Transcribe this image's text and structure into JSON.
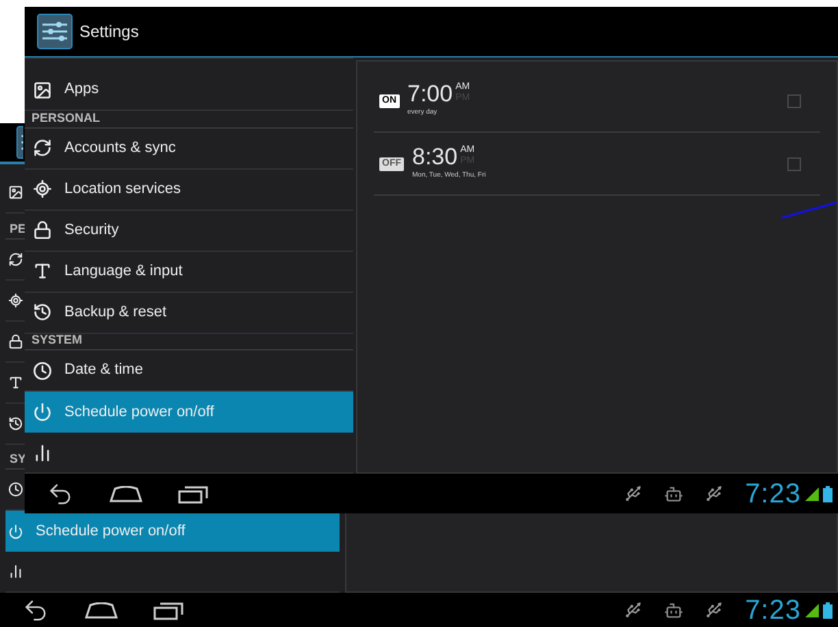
{
  "back_screen": {
    "list": [
      {
        "kind": "item"
      },
      {
        "kind": "header",
        "label": "PE"
      },
      {
        "kind": "item"
      },
      {
        "kind": "item"
      },
      {
        "kind": "item"
      },
      {
        "kind": "item"
      },
      {
        "kind": "item"
      },
      {
        "kind": "header",
        "label": "SY"
      },
      {
        "kind": "item"
      },
      {
        "kind": "item",
        "label": "Schedule power on/off",
        "selected": true
      },
      {
        "kind": "item",
        "selected": false
      }
    ],
    "status_bar": {
      "time": "7:23"
    }
  },
  "front_screen": {
    "title": "Settings",
    "list": [
      {
        "kind": "item",
        "label": "Apps",
        "selected": false
      },
      {
        "kind": "header",
        "label": "PERSONAL"
      },
      {
        "kind": "item",
        "label": "Accounts & sync",
        "selected": false
      },
      {
        "kind": "item",
        "label": "Location services",
        "selected": false
      },
      {
        "kind": "item",
        "label": "Security",
        "selected": false
      },
      {
        "kind": "item",
        "label": "Language & input",
        "selected": false
      },
      {
        "kind": "item",
        "label": "Backup & reset",
        "selected": false
      },
      {
        "kind": "header",
        "label": "SYSTEM"
      },
      {
        "kind": "item",
        "label": "Date & time",
        "selected": false
      },
      {
        "kind": "item",
        "label": "Schedule power on/off",
        "selected": true
      },
      {
        "kind": "item",
        "selected": false
      }
    ],
    "alarms": [
      {
        "badge": "ON",
        "on": true,
        "time": "7:00",
        "am_label": "AM",
        "pm_label": "PM",
        "am": true,
        "repeat": "every day",
        "checked": false
      },
      {
        "badge": "OFF",
        "on": false,
        "time": "8:30",
        "am_label": "AM",
        "pm_label": "PM",
        "am": true,
        "repeat": "Mon, Tue, Wed, Thu, Fri",
        "checked": false
      }
    ],
    "status_bar": {
      "time": "7:23"
    }
  }
}
